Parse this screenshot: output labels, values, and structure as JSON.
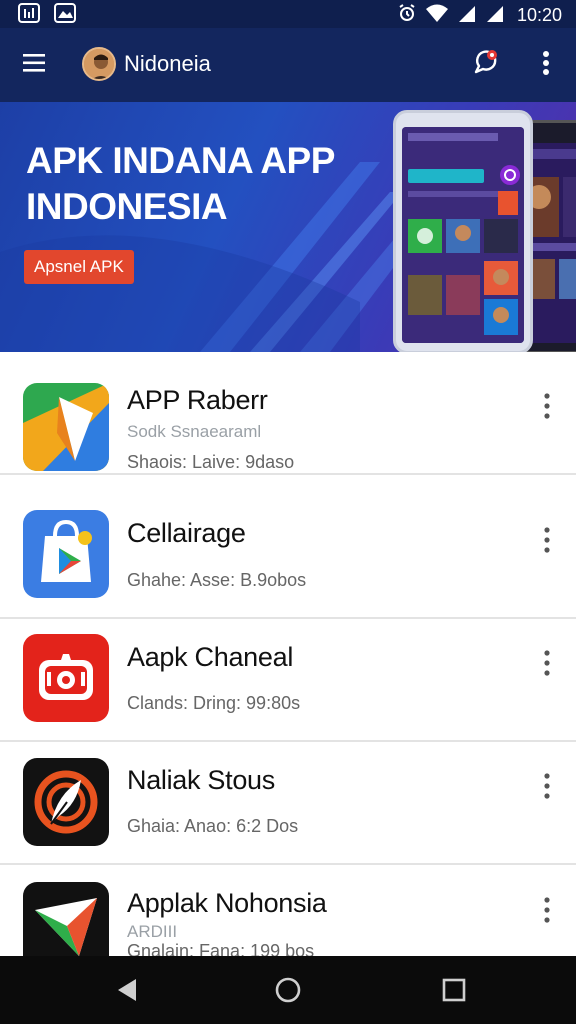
{
  "status_bar": {
    "time": "10:20",
    "icons": [
      "notification-box-icon",
      "image-icon",
      "alarm-icon",
      "wifi-icon",
      "signal-icon",
      "signal-icon"
    ]
  },
  "app_bar": {
    "title": "Nidoneia",
    "icons": [
      "menu-icon",
      "chat-icon",
      "more-vert-icon"
    ]
  },
  "banner": {
    "title_line1": "APK INDANA APP",
    "title_line2": "INDONESIA",
    "button_label": "Apsnel APK",
    "button_color": "#e2472d"
  },
  "apps": [
    {
      "name": "APP Raberr",
      "subtitle": "Sodk          Ssnaearaml",
      "meta": "Shaois: Laive: 9daso",
      "icon": "maps-icon"
    },
    {
      "name": "Cellairage",
      "subtitle": "",
      "meta": "Ghahe: Asse: B.9obos",
      "icon": "shopping-bag-icon"
    },
    {
      "name": "Aapk Chaneal",
      "subtitle": "",
      "meta": "Clands: Dring: 99:80s",
      "icon": "camera-icon"
    },
    {
      "name": "Naliak Stous",
      "subtitle": "",
      "meta": "Ghaia: Anao: 6:2 Dos",
      "icon": "feather-icon"
    },
    {
      "name": "Applak Nohonsia",
      "subtitle": "ARDIII",
      "meta": "Gnalain: Fana: 199 bos",
      "icon": "arrow-paper-icon"
    }
  ],
  "colors": {
    "status_bar": "#0f1f4e",
    "app_bar": "#13265e",
    "nav_bar": "#0b0b0b",
    "badge": "#e53935"
  }
}
